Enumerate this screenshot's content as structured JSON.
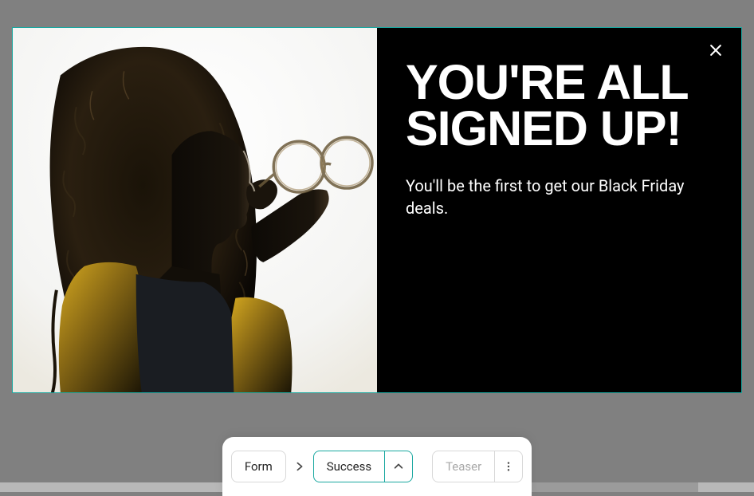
{
  "modal": {
    "headline": "YOU'RE ALL SIGNED UP!",
    "subtext": "You'll be the first to get our Black Friday deals.",
    "close_label": "Close"
  },
  "toolbar": {
    "steps": {
      "form": "Form",
      "success": "Success",
      "teaser": "Teaser"
    }
  },
  "icons": {
    "close": "close-icon",
    "chevron_right": "chevron-right-icon",
    "chevron_up": "chevron-up-icon",
    "more_vertical": "more-vertical-icon"
  }
}
